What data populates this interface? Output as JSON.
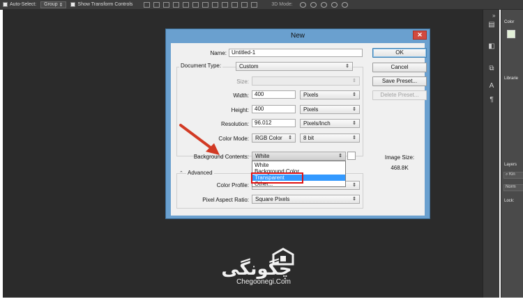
{
  "options_bar": {
    "auto_select_label": "Auto-Select:",
    "auto_select_value": "Group",
    "show_transform_label": "Show Transform Controls",
    "mode_3d_label": "3D Mode:"
  },
  "right_panel": {
    "color_label": "Color",
    "libraries_label": "Librarie",
    "layers_label": "Layers",
    "kind_placeholder": "Kin",
    "blend_value": "Norm",
    "lock_label": "Lock:"
  },
  "dialog": {
    "title": "New",
    "close_glyph": "✕",
    "name_label": "Name:",
    "name_value": "Untitled-1",
    "document_type_label": "Document Type:",
    "document_type_value": "Custom",
    "size_label": "Size:",
    "size_value": "",
    "width_label": "Width:",
    "width_value": "400",
    "width_unit": "Pixels",
    "height_label": "Height:",
    "height_value": "400",
    "height_unit": "Pixels",
    "resolution_label": "Resolution:",
    "resolution_value": "96.012",
    "resolution_unit": "Pixels/Inch",
    "color_mode_label": "Color Mode:",
    "color_mode_value": "RGB Color",
    "bit_depth_value": "8 bit",
    "background_label": "Background Contents:",
    "background_value": "White",
    "background_options": [
      "White",
      "Background Color",
      "Transparent",
      "Other..."
    ],
    "advanced_label": "Advanced",
    "color_profile_label": "Color Profile:",
    "pixel_aspect_label": "Pixel Aspect Ratio:",
    "pixel_aspect_value": "Square Pixels",
    "buttons": {
      "ok": "OK",
      "cancel": "Cancel",
      "save_preset": "Save Preset...",
      "delete_preset": "Delete Preset..."
    },
    "image_size_label": "Image Size:",
    "image_size_value": "468.8K"
  },
  "watermark": {
    "arabic": "چگونگی",
    "latin": "Chegoonegi.Com"
  },
  "colors": {
    "dialog_frame": "#6aa0cf",
    "highlight": "#e01010",
    "selection": "#3399ff",
    "canvas": "#2b2b2b"
  }
}
